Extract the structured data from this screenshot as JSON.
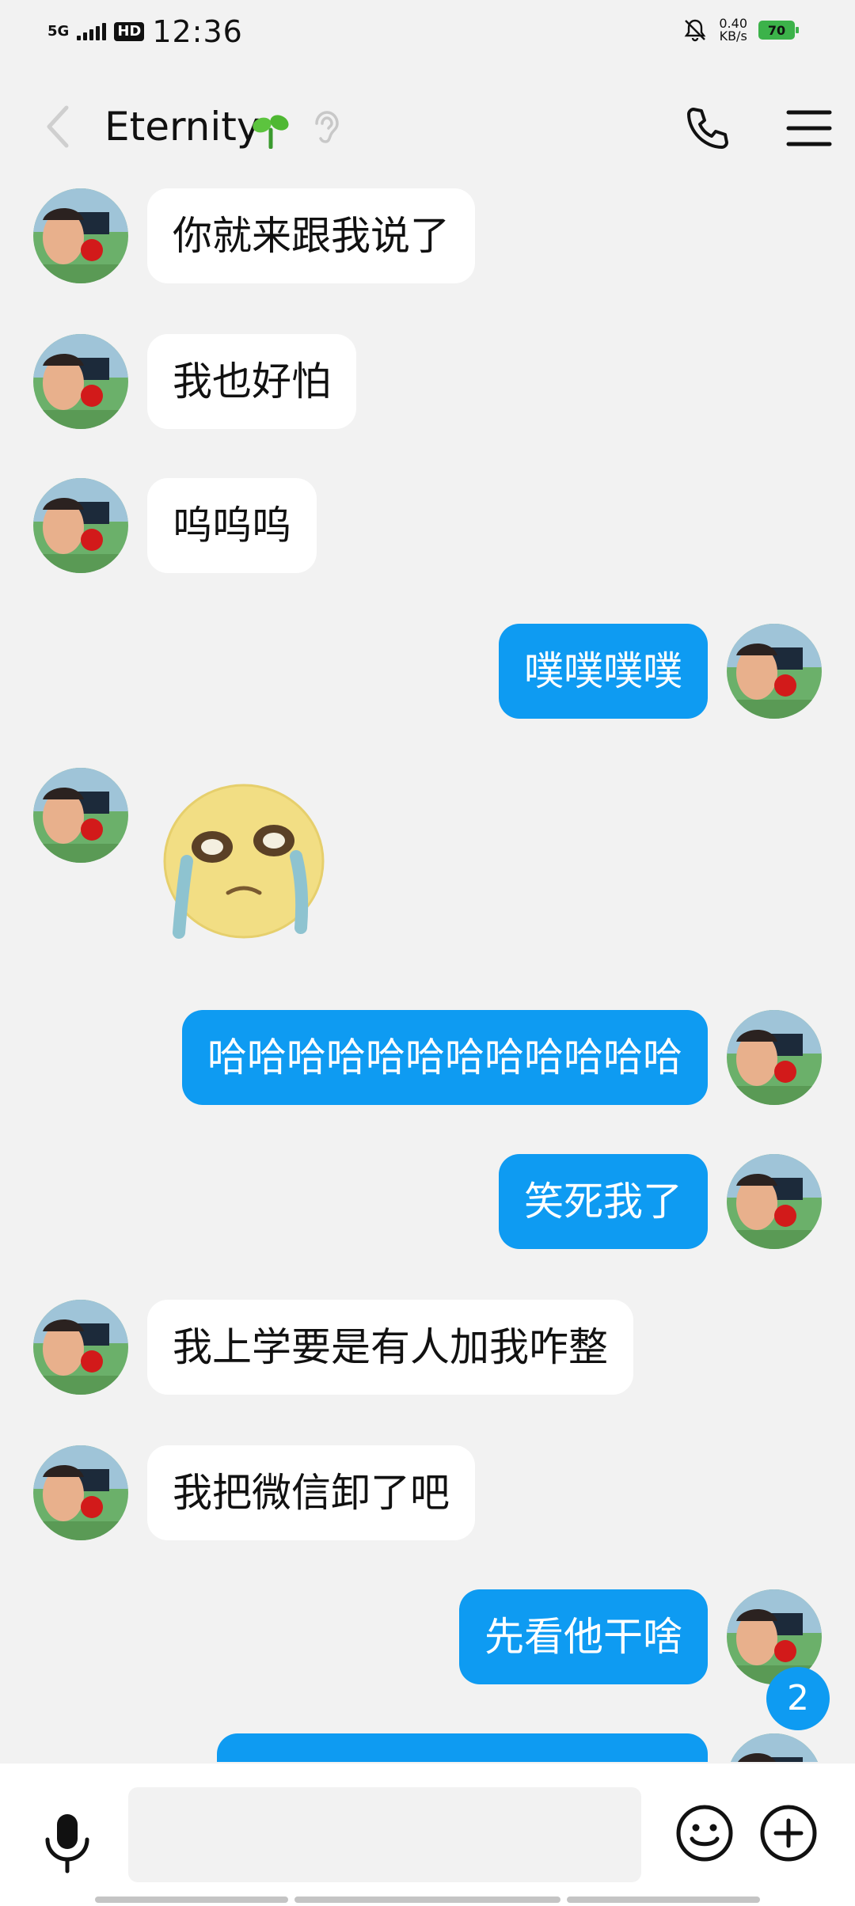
{
  "status_bar": {
    "network": "5G",
    "hd": "HD",
    "time": "12:36",
    "speed_value": "0.40",
    "speed_unit": "KB/s",
    "battery": "70"
  },
  "header": {
    "title": "Eternity"
  },
  "messages": [
    {
      "side": "in",
      "text": "你就来跟我说了"
    },
    {
      "side": "in",
      "text": "我也好怕"
    },
    {
      "side": "in",
      "text": "呜呜呜"
    },
    {
      "side": "out",
      "text": "噗噗噗噗"
    },
    {
      "side": "in",
      "type": "sticker",
      "sticker": "crying-face-sticker"
    },
    {
      "side": "out",
      "text": "哈哈哈哈哈哈哈哈哈哈哈哈"
    },
    {
      "side": "out",
      "text": "笑死我了"
    },
    {
      "side": "in",
      "text": "我上学要是有人加我咋整"
    },
    {
      "side": "in",
      "text": "我把微信卸了吧"
    },
    {
      "side": "out",
      "text": "先看他干啥"
    }
  ],
  "unread_count": "2",
  "input": {
    "placeholder": ""
  },
  "colors": {
    "accent": "#0e9bf2",
    "incoming_bubble": "#ffffff",
    "background": "#f2f2f2"
  }
}
